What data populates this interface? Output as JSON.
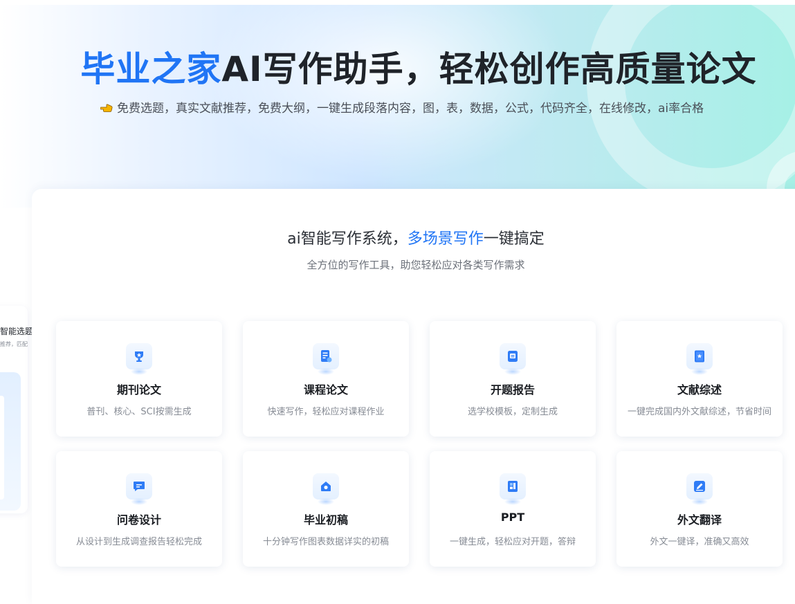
{
  "hero": {
    "title_brand": "毕业之家",
    "title_rest": "AI写作助手，轻松创作高质量论文",
    "subtitle": "免费选题，真实文献推荐，免费大纲，一键生成段落内容，图，表，数据，公式，代码齐全，在线修改，ai率合格",
    "subtitle_icon": "pointing-hand-icon"
  },
  "left_panel": {
    "title": "智能选题",
    "subtitle": "推荐，匹配"
  },
  "section": {
    "title_pre": "ai智能写作系统，",
    "title_highlight": "多场景写作",
    "title_post": "一键搞定",
    "subtitle": "全方位的写作工具，助您轻松应对各类写作需求"
  },
  "cards": [
    {
      "title": "期刊论文",
      "desc": "普刊、核心、SCI按需生成",
      "icon": "trophy-icon"
    },
    {
      "title": "课程论文",
      "desc": "快速写作，轻松应对课程作业",
      "icon": "document-icon"
    },
    {
      "title": "开题报告",
      "desc": "选学校模板，定制生成",
      "icon": "clipboard-icon"
    },
    {
      "title": "文献综述",
      "desc": "一键完成国内外文献综述，节省时间",
      "icon": "book-star-icon"
    },
    {
      "title": "问卷设计",
      "desc": "从设计到生成调查报告轻松完成",
      "icon": "chat-icon"
    },
    {
      "title": "毕业初稿",
      "desc": "十分钟写作图表数据详实的初稿",
      "icon": "graduation-icon"
    },
    {
      "title": "PPT",
      "desc": "一键生成，轻松应对开题，答辩",
      "icon": "presentation-icon"
    },
    {
      "title": "外文翻译",
      "desc": "外文一键译，准确又高效",
      "icon": "pen-icon"
    }
  ],
  "colors": {
    "accent": "#2075f5",
    "hero_gradient_start": "#eaf3ff",
    "hero_gradient_end": "#a6f0e6"
  }
}
